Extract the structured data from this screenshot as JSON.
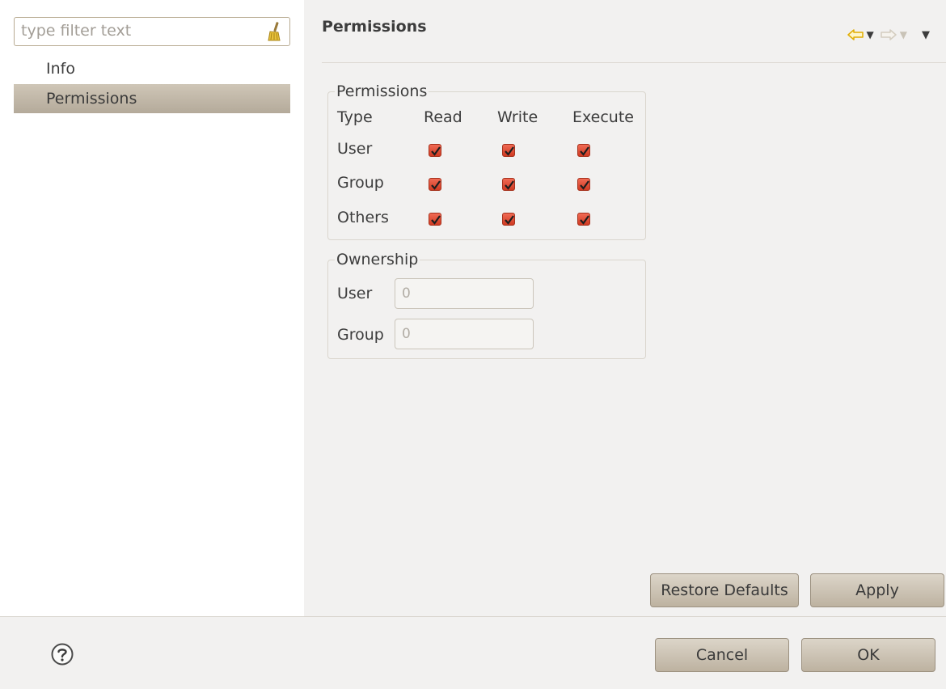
{
  "filter": {
    "placeholder": "type filter text",
    "icon": "broom-icon"
  },
  "tree": {
    "items": [
      {
        "label": "Info",
        "selected": false
      },
      {
        "label": "Permissions",
        "selected": true
      }
    ]
  },
  "page": {
    "title": "Permissions",
    "nav": {
      "back_icon": "back-arrow-icon",
      "forward_icon": "forward-arrow-icon",
      "menu_icon": "view-menu-icon"
    }
  },
  "permissions": {
    "group_title": "Permissions",
    "headers": {
      "type": "Type",
      "read": "Read",
      "write": "Write",
      "execute": "Execute"
    },
    "rows": [
      {
        "label": "User",
        "read": true,
        "write": true,
        "execute": true
      },
      {
        "label": "Group",
        "read": true,
        "write": true,
        "execute": true
      },
      {
        "label": "Others",
        "read": true,
        "write": true,
        "execute": true
      }
    ]
  },
  "ownership": {
    "group_title": "Ownership",
    "user_label": "User",
    "user_value": "0",
    "group_label": "Group",
    "group_value": "0"
  },
  "buttons": {
    "restore_defaults": "Restore Defaults",
    "apply": "Apply",
    "cancel": "Cancel",
    "ok": "OK"
  },
  "colors": {
    "checkbox": "#e0503a",
    "selected_row": "#bdb3a3",
    "nav_arrow": "#e8b400"
  }
}
